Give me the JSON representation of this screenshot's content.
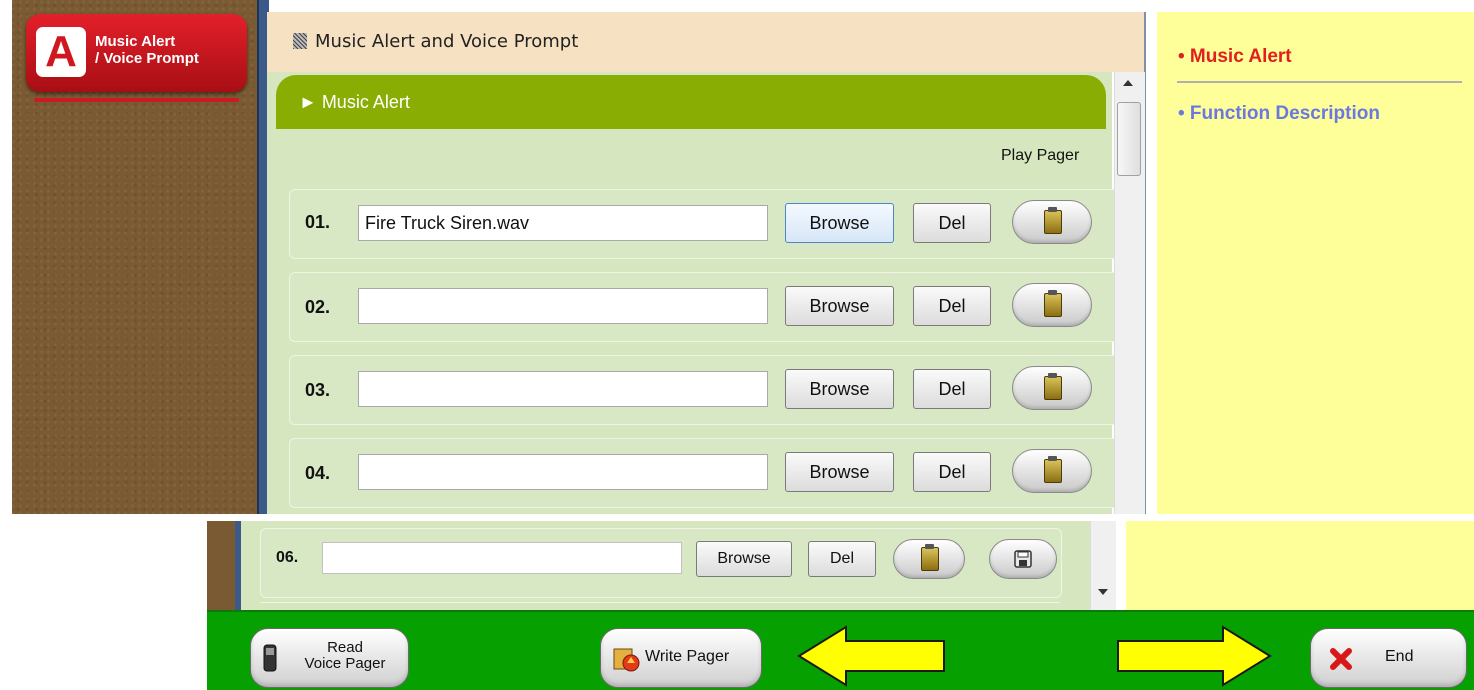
{
  "app_button": {
    "badge": "A",
    "line1": "Music Alert",
    "line2": "/ Voice Prompt"
  },
  "header": {
    "title": "Music Alert and Voice Prompt"
  },
  "section": {
    "label": "► Music Alert"
  },
  "columns": {
    "play_pager": "Play Pager"
  },
  "rows": [
    {
      "num": "01.",
      "file": "Fire Truck Siren.wav",
      "browse": "Browse",
      "del": "Del"
    },
    {
      "num": "02.",
      "file": "",
      "browse": "Browse",
      "del": "Del"
    },
    {
      "num": "03.",
      "file": "",
      "browse": "Browse",
      "del": "Del"
    },
    {
      "num": "04.",
      "file": "",
      "browse": "Browse",
      "del": "Del"
    }
  ],
  "bottom_row": {
    "num": "06.",
    "file": "",
    "browse": "Browse",
    "del": "Del"
  },
  "right_panel": {
    "item1": "• Music Alert",
    "item2": "•  Function  Description"
  },
  "footer": {
    "read_line1": "Read",
    "read_line2": "Voice Pager",
    "write_label": "Write Pager",
    "end_label": "End"
  },
  "colors": {
    "section_green": "#8aad04",
    "footer_green": "#06a000",
    "alert_red": "#e02020",
    "link_blue": "#6a78e0",
    "arrow_yellow": "#ffff00"
  },
  "icons": [
    "pager-play-icon",
    "save-icon",
    "phone-icon",
    "write-pager-icon",
    "close-x-icon"
  ]
}
